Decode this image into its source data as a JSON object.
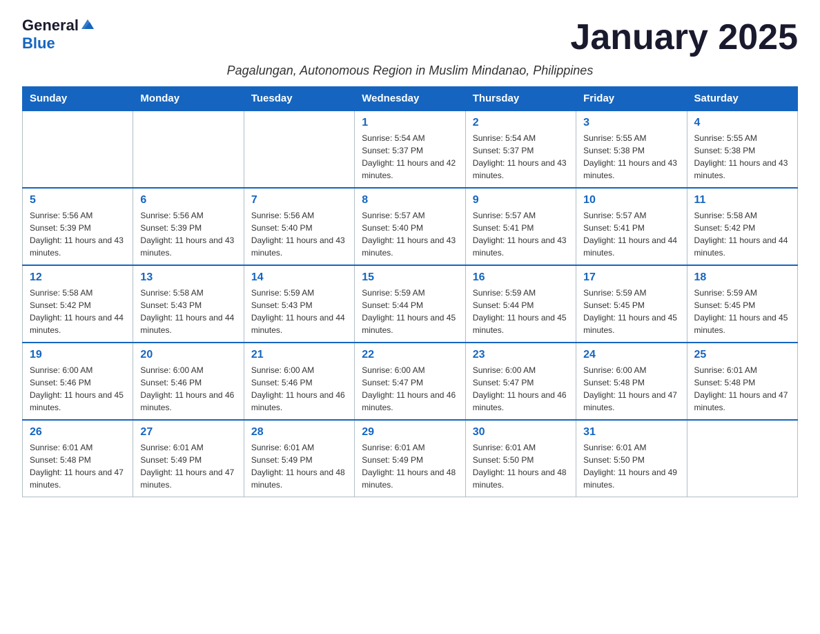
{
  "logo": {
    "general": "General",
    "blue": "Blue"
  },
  "title": "January 2025",
  "subtitle": "Pagalungan, Autonomous Region in Muslim Mindanao, Philippines",
  "days_of_week": [
    "Sunday",
    "Monday",
    "Tuesday",
    "Wednesday",
    "Thursday",
    "Friday",
    "Saturday"
  ],
  "weeks": [
    [
      {
        "day": "",
        "info": ""
      },
      {
        "day": "",
        "info": ""
      },
      {
        "day": "",
        "info": ""
      },
      {
        "day": "1",
        "info": "Sunrise: 5:54 AM\nSunset: 5:37 PM\nDaylight: 11 hours and 42 minutes."
      },
      {
        "day": "2",
        "info": "Sunrise: 5:54 AM\nSunset: 5:37 PM\nDaylight: 11 hours and 43 minutes."
      },
      {
        "day": "3",
        "info": "Sunrise: 5:55 AM\nSunset: 5:38 PM\nDaylight: 11 hours and 43 minutes."
      },
      {
        "day": "4",
        "info": "Sunrise: 5:55 AM\nSunset: 5:38 PM\nDaylight: 11 hours and 43 minutes."
      }
    ],
    [
      {
        "day": "5",
        "info": "Sunrise: 5:56 AM\nSunset: 5:39 PM\nDaylight: 11 hours and 43 minutes."
      },
      {
        "day": "6",
        "info": "Sunrise: 5:56 AM\nSunset: 5:39 PM\nDaylight: 11 hours and 43 minutes."
      },
      {
        "day": "7",
        "info": "Sunrise: 5:56 AM\nSunset: 5:40 PM\nDaylight: 11 hours and 43 minutes."
      },
      {
        "day": "8",
        "info": "Sunrise: 5:57 AM\nSunset: 5:40 PM\nDaylight: 11 hours and 43 minutes."
      },
      {
        "day": "9",
        "info": "Sunrise: 5:57 AM\nSunset: 5:41 PM\nDaylight: 11 hours and 43 minutes."
      },
      {
        "day": "10",
        "info": "Sunrise: 5:57 AM\nSunset: 5:41 PM\nDaylight: 11 hours and 44 minutes."
      },
      {
        "day": "11",
        "info": "Sunrise: 5:58 AM\nSunset: 5:42 PM\nDaylight: 11 hours and 44 minutes."
      }
    ],
    [
      {
        "day": "12",
        "info": "Sunrise: 5:58 AM\nSunset: 5:42 PM\nDaylight: 11 hours and 44 minutes."
      },
      {
        "day": "13",
        "info": "Sunrise: 5:58 AM\nSunset: 5:43 PM\nDaylight: 11 hours and 44 minutes."
      },
      {
        "day": "14",
        "info": "Sunrise: 5:59 AM\nSunset: 5:43 PM\nDaylight: 11 hours and 44 minutes."
      },
      {
        "day": "15",
        "info": "Sunrise: 5:59 AM\nSunset: 5:44 PM\nDaylight: 11 hours and 45 minutes."
      },
      {
        "day": "16",
        "info": "Sunrise: 5:59 AM\nSunset: 5:44 PM\nDaylight: 11 hours and 45 minutes."
      },
      {
        "day": "17",
        "info": "Sunrise: 5:59 AM\nSunset: 5:45 PM\nDaylight: 11 hours and 45 minutes."
      },
      {
        "day": "18",
        "info": "Sunrise: 5:59 AM\nSunset: 5:45 PM\nDaylight: 11 hours and 45 minutes."
      }
    ],
    [
      {
        "day": "19",
        "info": "Sunrise: 6:00 AM\nSunset: 5:46 PM\nDaylight: 11 hours and 45 minutes."
      },
      {
        "day": "20",
        "info": "Sunrise: 6:00 AM\nSunset: 5:46 PM\nDaylight: 11 hours and 46 minutes."
      },
      {
        "day": "21",
        "info": "Sunrise: 6:00 AM\nSunset: 5:46 PM\nDaylight: 11 hours and 46 minutes."
      },
      {
        "day": "22",
        "info": "Sunrise: 6:00 AM\nSunset: 5:47 PM\nDaylight: 11 hours and 46 minutes."
      },
      {
        "day": "23",
        "info": "Sunrise: 6:00 AM\nSunset: 5:47 PM\nDaylight: 11 hours and 46 minutes."
      },
      {
        "day": "24",
        "info": "Sunrise: 6:00 AM\nSunset: 5:48 PM\nDaylight: 11 hours and 47 minutes."
      },
      {
        "day": "25",
        "info": "Sunrise: 6:01 AM\nSunset: 5:48 PM\nDaylight: 11 hours and 47 minutes."
      }
    ],
    [
      {
        "day": "26",
        "info": "Sunrise: 6:01 AM\nSunset: 5:48 PM\nDaylight: 11 hours and 47 minutes."
      },
      {
        "day": "27",
        "info": "Sunrise: 6:01 AM\nSunset: 5:49 PM\nDaylight: 11 hours and 47 minutes."
      },
      {
        "day": "28",
        "info": "Sunrise: 6:01 AM\nSunset: 5:49 PM\nDaylight: 11 hours and 48 minutes."
      },
      {
        "day": "29",
        "info": "Sunrise: 6:01 AM\nSunset: 5:49 PM\nDaylight: 11 hours and 48 minutes."
      },
      {
        "day": "30",
        "info": "Sunrise: 6:01 AM\nSunset: 5:50 PM\nDaylight: 11 hours and 48 minutes."
      },
      {
        "day": "31",
        "info": "Sunrise: 6:01 AM\nSunset: 5:50 PM\nDaylight: 11 hours and 49 minutes."
      },
      {
        "day": "",
        "info": ""
      }
    ]
  ]
}
